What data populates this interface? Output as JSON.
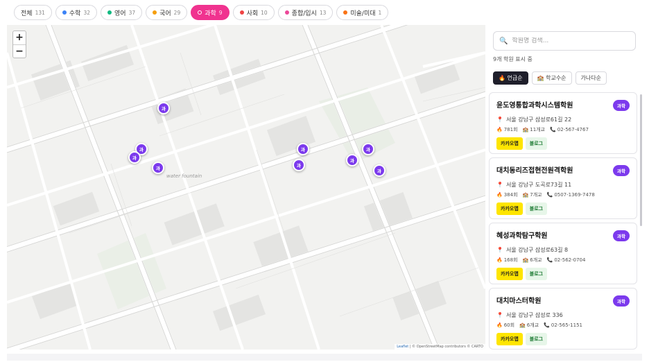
{
  "filters": [
    {
      "label": "전체",
      "count": "131",
      "color": ""
    },
    {
      "label": "수학",
      "count": "32",
      "color": "#3b82f6"
    },
    {
      "label": "영어",
      "count": "37",
      "color": "#10b981"
    },
    {
      "label": "국어",
      "count": "29",
      "color": "#f59e0b"
    },
    {
      "label": "과학",
      "count": "9",
      "color": "#f0338f",
      "active": true
    },
    {
      "label": "사회",
      "count": "10",
      "color": "#ef4444"
    },
    {
      "label": "종합/입시",
      "count": "13",
      "color": "#ec4899"
    },
    {
      "label": "미술/미대",
      "count": "1",
      "color": "#f97316"
    }
  ],
  "map": {
    "zoom_in": "+",
    "zoom_out": "−",
    "marker_label": "과",
    "marker_color": "#7c3aed",
    "water_label": "water fountain",
    "attribution_leaflet": "Leaflet",
    "attribution_rest": " | © OpenStreetMap contributors © CARTO"
  },
  "sidebar": {
    "search_placeholder": "학원명 검색...",
    "count_text": "9개 학원 표시 중",
    "sort": [
      "🔥 언급순",
      "🏫 학교수순",
      "가나다순"
    ],
    "academies": [
      {
        "name": "윤도영통합과학시스템학원",
        "badge": "과학",
        "address": "서울 강남구 삼성로61길 22",
        "mentions": "781회",
        "schools": "11개교",
        "phone": "02-567-4767",
        "kakao": "카카오맵",
        "blog": "블로그"
      },
      {
        "name": "대치동리즈접현전원격학원",
        "badge": "과학",
        "address": "서울 강남구 도곡로73길 11",
        "mentions": "384회",
        "schools": "7개교",
        "phone": "0507-1369-7478",
        "kakao": "카카오맵",
        "blog": "블로그"
      },
      {
        "name": "혜성과학탐구학원",
        "badge": "과학",
        "address": "서울 강남구 삼성로63길 8",
        "mentions": "168회",
        "schools": "6개교",
        "phone": "02-562-0704",
        "kakao": "카카오맵",
        "blog": "블로그"
      },
      {
        "name": "대치마스터학원",
        "badge": "과학",
        "address": "서울 강남구 삼성로 336",
        "mentions": "60회",
        "schools": "6개교",
        "phone": "02-565-1151",
        "kakao": "카카오맵",
        "blog": "블로그"
      }
    ]
  }
}
